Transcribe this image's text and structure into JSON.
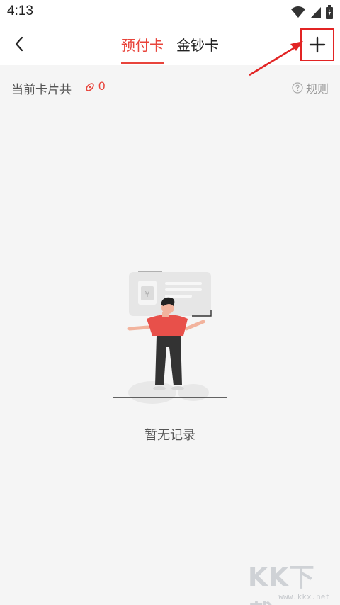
{
  "status_bar": {
    "time": "4:13"
  },
  "nav": {
    "tabs": [
      {
        "label": "预付卡",
        "active": true
      },
      {
        "label": "金钞卡",
        "active": false
      }
    ],
    "add_label": "+"
  },
  "info": {
    "count_label": "当前卡片共",
    "count_value": "0",
    "rules_label": "规则"
  },
  "empty": {
    "text": "暂无记录"
  },
  "watermark": {
    "logo": "KK下载",
    "url": "www.kkx.net"
  },
  "colors": {
    "accent": "#e8443b",
    "annotation": "#e22424",
    "background": "#f5f5f5"
  }
}
